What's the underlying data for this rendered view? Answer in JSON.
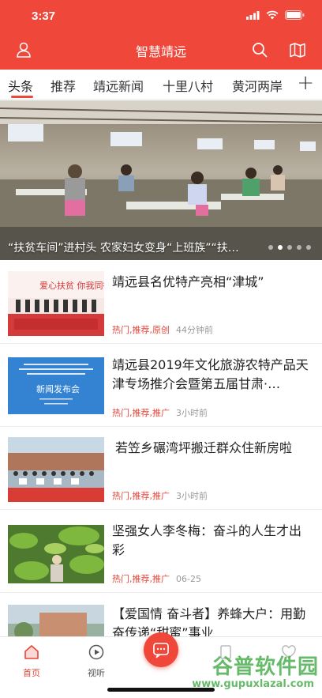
{
  "status": {
    "time": "3:37"
  },
  "header": {
    "title": "智慧靖远",
    "bg_color": "#f0473b"
  },
  "tabs": [
    {
      "label": "头条",
      "active": true
    },
    {
      "label": "推荐"
    },
    {
      "label": "靖远新闻"
    },
    {
      "label": "十里八村"
    },
    {
      "label": "黄河两岸"
    }
  ],
  "tab_add": "+",
  "banner": {
    "caption": "“扶贫车间”进村头 农家妇女变身“上班族”“扶…",
    "active_dot": 1
  },
  "news": [
    {
      "title": "靖远县名优特产亮相“津城”",
      "tags": "热门,推荐,原创",
      "time": "44分钟前"
    },
    {
      "title": "靖远县2019年文化旅游农特产品天津专场推介会暨第五届甘肃·…",
      "tags": "热门,推荐,推广",
      "time": "3小时前"
    },
    {
      "title": "若笠乡碾湾坪搬迁群众住新房啦",
      "tags": "热门,推荐,推广",
      "time": "3小时前"
    },
    {
      "title": "坚强女人李冬梅：奋斗的人生才出彩",
      "tags": "热门,推荐,推广",
      "time": "06-25"
    },
    {
      "title": "【爱国情 奋斗者】养蜂大户：用勤奋传递“甜蜜”事业",
      "tags": "",
      "time": ""
    }
  ],
  "thumb_texts": {
    "news1_banner": "爱心扶贫 你我同行",
    "news2_heading": "新闻发布会"
  },
  "tabbar": {
    "home": "首页",
    "video": "视听"
  },
  "watermark": {
    "brand": "谷普软件园",
    "url": "www.gupuxlazal.com"
  }
}
